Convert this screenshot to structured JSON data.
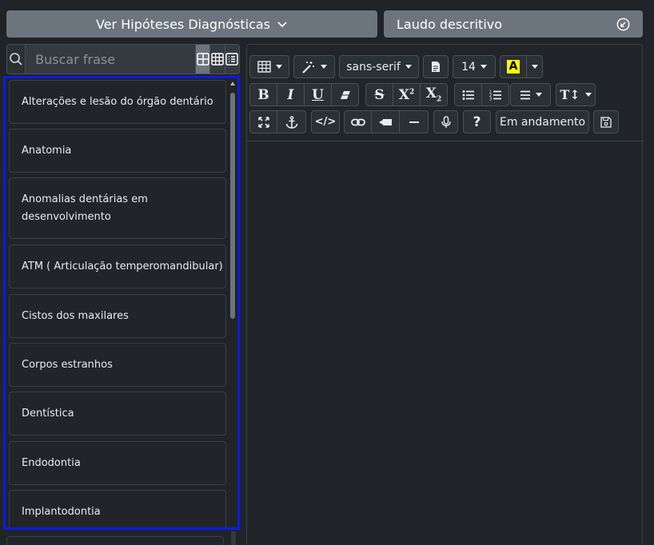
{
  "header": {
    "hipoteses_label": "Ver Hipóteses Diagnósticas",
    "laudo_label": "Laudo descritivo"
  },
  "search": {
    "placeholder": "Buscar frase"
  },
  "list": {
    "items": [
      "Alterações e lesão do órgão dentário",
      "Anatomia",
      "Anomalias dentárias em desenvolvimento",
      "ATM ( Articulação temperomandibular)",
      "Cistos dos maxilares",
      "Corpos estranhos",
      "Dentística",
      "Endodontia",
      "Implantodontia"
    ]
  },
  "editor": {
    "font_family": "sans-serif",
    "font_size": "14",
    "status_label": "Em andamento"
  },
  "colors": {
    "highlight": "#ffff00",
    "selection_border": "#0a1ae8",
    "button": "#6c757d"
  }
}
